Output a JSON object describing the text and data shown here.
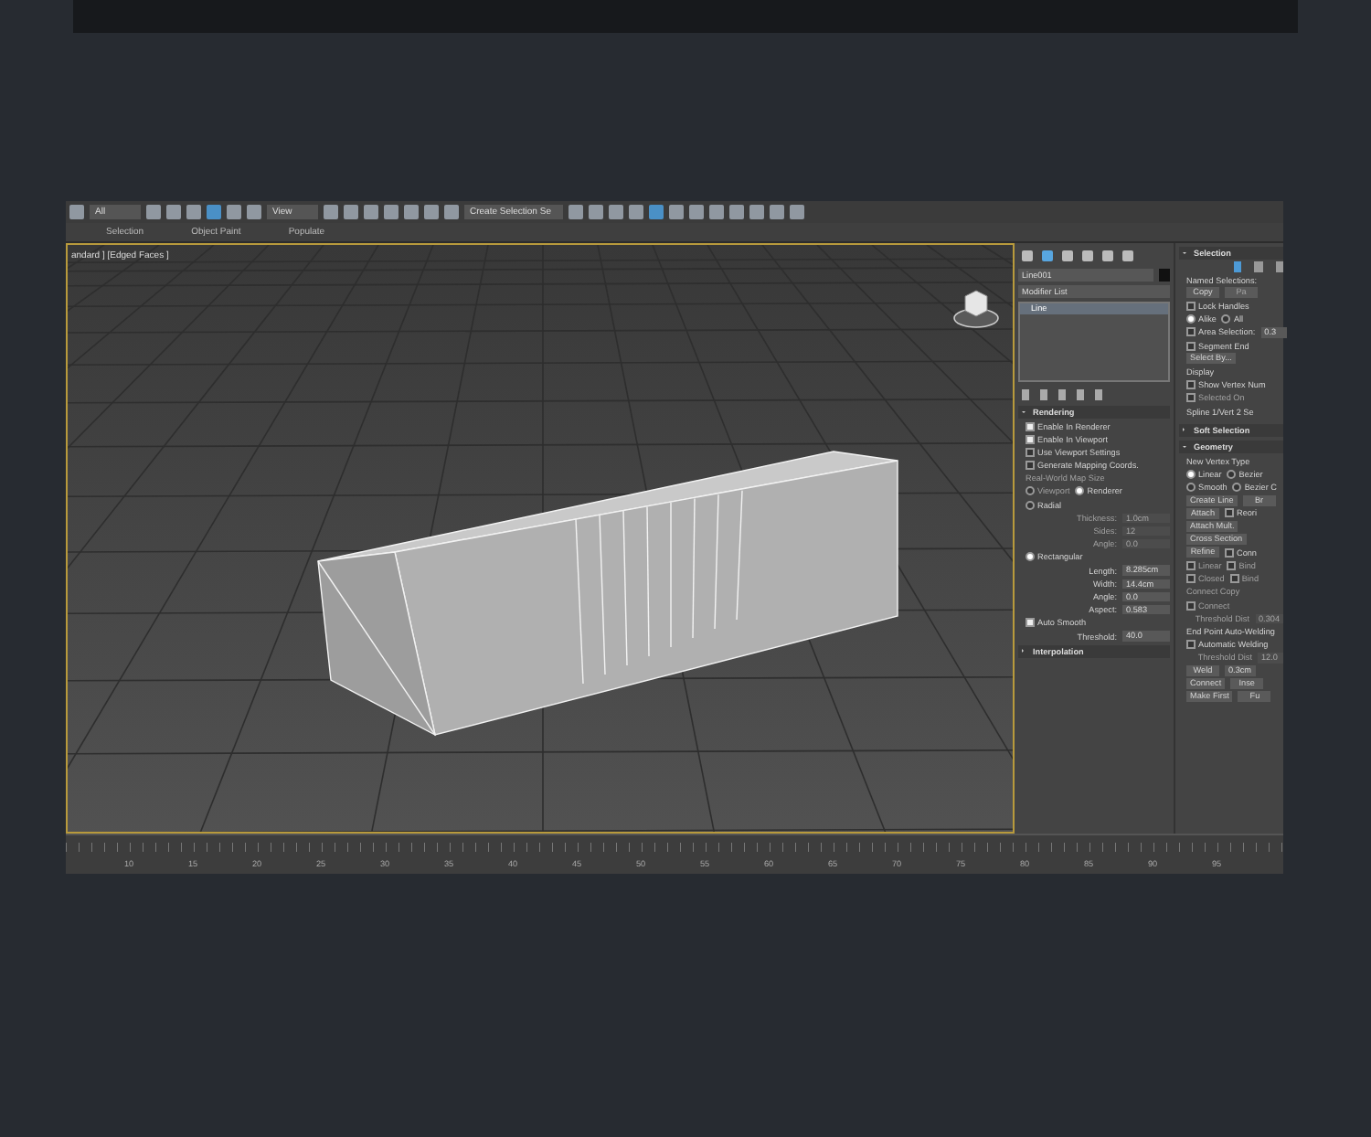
{
  "toolbar": {
    "dropdowns": [
      "All",
      "View",
      "Create Selection Se"
    ]
  },
  "ribbon": {
    "tabs": [
      {
        "label": "Selection",
        "selected": false
      },
      {
        "label": "Object Paint",
        "selected": false
      },
      {
        "label": "Populate",
        "selected": false
      }
    ]
  },
  "viewport": {
    "label": "andard ] [Edged Faces ]"
  },
  "command_panel": {
    "object_name": "Line001",
    "modifier_list": "Modifier List",
    "stack": [
      {
        "label": "Line",
        "selected": true
      }
    ],
    "rendering": {
      "title": "Rendering",
      "expanded": true,
      "rows": [
        [
          {
            "kind": "check",
            "label": "Enable In Renderer",
            "checked": true
          }
        ],
        [
          {
            "kind": "check",
            "label": "Enable In Viewport",
            "checked": true
          }
        ],
        [
          {
            "kind": "check",
            "label": "Use Viewport Settings",
            "checked": false
          }
        ],
        [
          {
            "kind": "check",
            "label": "Generate Mapping Coords.",
            "checked": false
          }
        ],
        [
          {
            "kind": "text",
            "label": "Real-World Map Size",
            "disabled": true
          }
        ],
        [
          {
            "kind": "radio",
            "label": "Viewport",
            "selected": false,
            "disabled": true
          },
          {
            "kind": "radio",
            "label": "Renderer",
            "selected": true
          }
        ],
        [
          {
            "kind": "radio",
            "label": "Radial",
            "selected": false
          }
        ],
        [
          {
            "kind": "spinner",
            "label": "Thickness:",
            "value": "1.0cm",
            "disabled": true
          }
        ],
        [
          {
            "kind": "spinner",
            "label": "Sides:",
            "value": "12",
            "disabled": true
          }
        ],
        [
          {
            "kind": "spinner",
            "label": "Angle:",
            "value": "0.0",
            "disabled": true
          }
        ],
        [
          {
            "kind": "radio",
            "label": "Rectangular",
            "selected": true
          }
        ],
        [
          {
            "kind": "spinner",
            "label": "Length:",
            "value": "8.285cm"
          }
        ],
        [
          {
            "kind": "spinner",
            "label": "Width:",
            "value": "14.4cm"
          }
        ],
        [
          {
            "kind": "spinner",
            "label": "Angle:",
            "value": "0.0"
          }
        ],
        [
          {
            "kind": "spinner",
            "label": "Aspect:",
            "value": "0.583"
          }
        ],
        [
          {
            "kind": "check",
            "label": "Auto Smooth",
            "checked": true
          }
        ],
        [
          {
            "kind": "spinner",
            "label": "Threshold:",
            "value": "40.0"
          }
        ]
      ]
    },
    "interpolation": {
      "title": "Interpolation",
      "expanded": false
    },
    "right_column": [
      {
        "title": "Selection",
        "expanded": true,
        "rows": [
          [
            {
              "kind": "icons"
            }
          ],
          [
            {
              "kind": "text",
              "label": "Named Selections:"
            }
          ],
          [
            {
              "kind": "button",
              "label": "Copy"
            },
            {
              "kind": "button",
              "label": "Pa",
              "disabled": true
            }
          ],
          [
            {
              "kind": "check",
              "label": "Lock Handles",
              "checked": false
            }
          ],
          [
            {
              "kind": "radio",
              "label": "Alike",
              "selected": true
            },
            {
              "kind": "radio",
              "label": "All",
              "selected": false
            }
          ],
          [
            {
              "kind": "check",
              "label": "Area Selection:",
              "checked": false
            },
            {
              "kind": "field",
              "value": "0.3"
            }
          ],
          [
            {
              "kind": "check",
              "label": "Segment End",
              "checked": false
            }
          ],
          [
            {
              "kind": "button",
              "label": "Select By..."
            }
          ],
          [
            {
              "kind": "text",
              "label": "Display"
            }
          ],
          [
            {
              "kind": "check",
              "label": "Show Vertex Num",
              "checked": false
            }
          ],
          [
            {
              "kind": "check",
              "label": "Selected On",
              "checked": false,
              "disabled": true
            }
          ],
          [
            {
              "kind": "text",
              "label": "Spline 1/Vert 2 Se"
            }
          ]
        ]
      },
      {
        "title": "Soft Selection",
        "expanded": false
      },
      {
        "title": "Geometry",
        "expanded": true,
        "rows": [
          [
            {
              "kind": "text",
              "label": "New Vertex Type"
            }
          ],
          [
            {
              "kind": "radio",
              "label": "Linear",
              "selected": true
            },
            {
              "kind": "radio",
              "label": "Bezier",
              "selected": false
            }
          ],
          [
            {
              "kind": "radio",
              "label": "Smooth",
              "selected": false
            },
            {
              "kind": "radio",
              "label": "Bezier C",
              "selected": false
            }
          ],
          [
            {
              "kind": "button",
              "label": "Create Line"
            },
            {
              "kind": "button",
              "label": "Br"
            }
          ],
          [
            {
              "kind": "button",
              "label": "Attach"
            },
            {
              "kind": "check",
              "label": "Reori",
              "checked": false
            }
          ],
          [
            {
              "kind": "button",
              "label": "Attach Mult."
            }
          ],
          [
            {
              "kind": "button",
              "label": "Cross Section"
            }
          ],
          [
            {
              "kind": "button",
              "label": "Refine"
            },
            {
              "kind": "check",
              "label": "Conn",
              "checked": false
            }
          ],
          [
            {
              "kind": "check",
              "label": "Linear",
              "checked": false,
              "disabled": true
            },
            {
              "kind": "check",
              "label": "Bind",
              "checked": false,
              "disabled": true
            }
          ],
          [
            {
              "kind": "check",
              "label": "Closed",
              "checked": false,
              "disabled": true
            },
            {
              "kind": "check",
              "label": "Bind",
              "checked": false,
              "disabled": true
            }
          ],
          [
            {
              "kind": "text",
              "label": "Connect Copy",
              "disabled": true
            }
          ],
          [
            {
              "kind": "check",
              "label": "Connect",
              "checked": false,
              "disabled": true
            }
          ],
          [
            {
              "kind": "spinner",
              "label": "Threshold Dist",
              "value": "0.304",
              "disabled": true
            }
          ],
          [
            {
              "kind": "text",
              "label": "End Point Auto-Welding"
            }
          ],
          [
            {
              "kind": "check",
              "label": "Automatic Welding",
              "checked": false
            }
          ],
          [
            {
              "kind": "spinner",
              "label": "Threshold Dist",
              "value": "12.0",
              "disabled": true
            }
          ],
          [
            {
              "kind": "button",
              "label": "Weld"
            },
            {
              "kind": "field",
              "value": "0.3cm"
            }
          ],
          [
            {
              "kind": "button",
              "label": "Connect"
            },
            {
              "kind": "button",
              "label": "Inse"
            }
          ],
          [
            {
              "kind": "button",
              "label": "Make First"
            },
            {
              "kind": "button",
              "label": "Fu"
            }
          ]
        ]
      }
    ]
  },
  "timeline": {
    "ticks": [
      "10",
      "15",
      "20",
      "25",
      "30",
      "35",
      "40",
      "45",
      "50",
      "55",
      "60",
      "65",
      "70",
      "75",
      "80",
      "85",
      "90",
      "95"
    ]
  }
}
